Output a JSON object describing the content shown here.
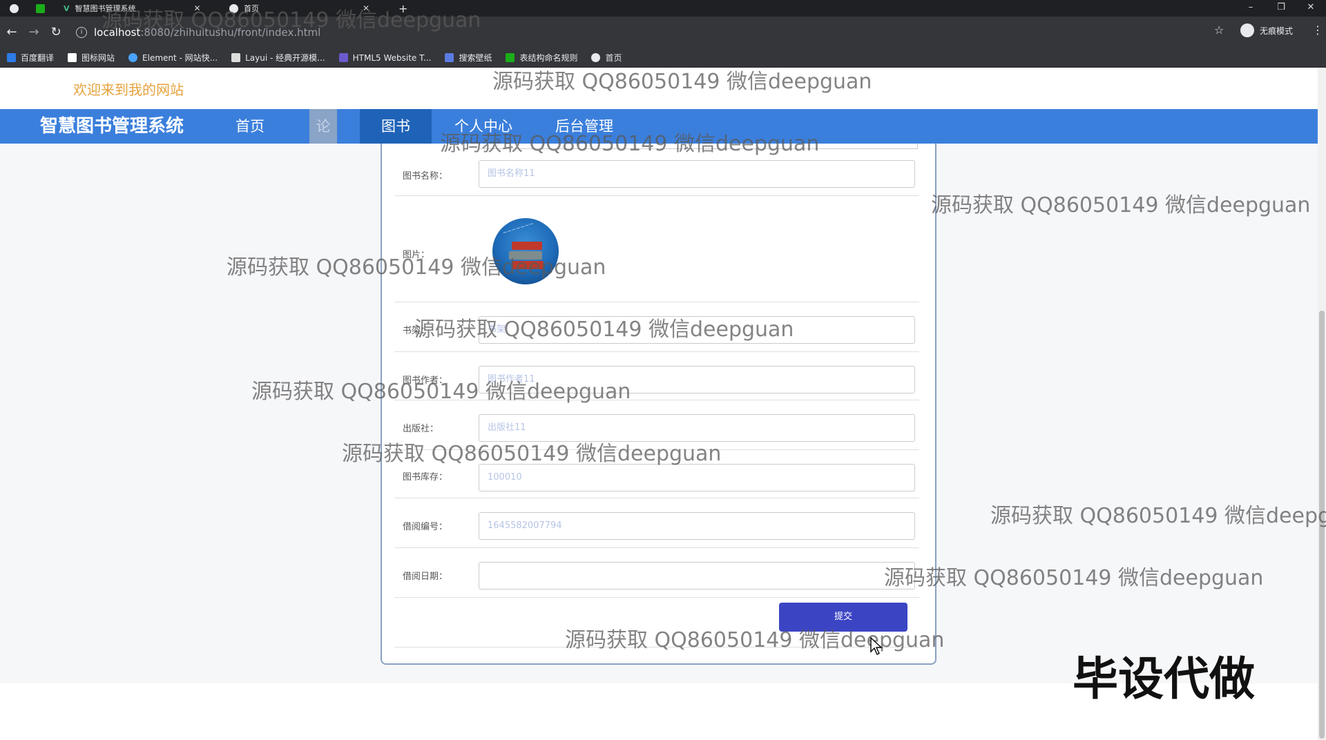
{
  "browser": {
    "tabs": [
      {
        "title": "智慧图书管理系统",
        "active": false
      },
      {
        "title": "首页",
        "active": true
      }
    ],
    "new_tab_label": "+",
    "close_label": "✕",
    "window_controls": {
      "minimize": "–",
      "maximize": "❐",
      "close": "✕"
    },
    "url": {
      "host": "localhost",
      "path": ":8080/zhihuitushu/front/index.html"
    },
    "profile_label": "无痕模式",
    "bookmarks": [
      {
        "label": "百度翻译",
        "color": "#2d7be5"
      },
      {
        "label": "图标网站",
        "color": "#ffffff"
      },
      {
        "label": "Element - 网站快...",
        "color": "#4aa3ff"
      },
      {
        "label": "Layui - 经典开源模...",
        "color": "#dddddd"
      },
      {
        "label": "HTML5 Website T...",
        "color": "#6a5acd"
      },
      {
        "label": "搜索壁纸",
        "color": "#5a7be0"
      },
      {
        "label": "表结构命名规则",
        "color": "#1aad19"
      },
      {
        "label": "首页",
        "color": "#e8eaed"
      }
    ]
  },
  "site": {
    "welcome": "欢迎来到我的网站",
    "brand": "智慧图书管理系统",
    "nav": [
      {
        "label": "首页",
        "state": "normal"
      },
      {
        "label": "论坛",
        "state": "hover"
      },
      {
        "label": "图书",
        "state": "active"
      },
      {
        "label": "个人中心",
        "state": "normal"
      },
      {
        "label": "后台管理",
        "state": "normal"
      }
    ],
    "colors": {
      "nav_bg": "#3b7fdc",
      "nav_active": "#1f63b8",
      "welcome": "#e6a23c",
      "submit": "#3b45c4"
    }
  },
  "form": {
    "fields": [
      {
        "label": "图书名称：",
        "value": "图书名称11"
      },
      {
        "label": "图片：",
        "image": "book-stack-image"
      },
      {
        "label": "书架：",
        "value": "书架"
      },
      {
        "label": "图书作者：",
        "value": "图书作者11"
      },
      {
        "label": "出版社：",
        "value": "出版社11"
      },
      {
        "label": "图书库存：",
        "value": "100010"
      },
      {
        "label": "借阅编号：",
        "value": "1645582007794"
      },
      {
        "label": "借阅日期：",
        "value": ""
      }
    ],
    "submit_label": "提交"
  },
  "overlay": {
    "watermark": "源码获取 QQ86050149 微信deepguan",
    "big_tag": "毕设代做"
  }
}
